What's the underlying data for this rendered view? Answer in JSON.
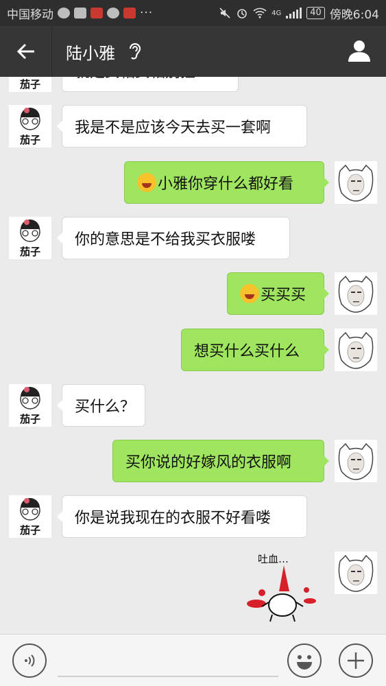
{
  "statusbar": {
    "carrier": "中国移动",
    "network": "4G",
    "battery": "40",
    "time": "傍晚6:04",
    "more": "···"
  },
  "header": {
    "title": "陆小雅"
  },
  "messages": [
    {
      "side": "in",
      "text": "就是女相女相别扭",
      "partial": true
    },
    {
      "side": "in",
      "text": "我是不是应该今天去买一套啊"
    },
    {
      "side": "out",
      "text": "小雅你穿什么都好看",
      "emoji": "laugh-cry-emoji"
    },
    {
      "side": "in",
      "text": "你的意思是不给我买衣服喽"
    },
    {
      "side": "out",
      "text": "买买买",
      "emoji": "laugh-cry-emoji"
    },
    {
      "side": "out",
      "text": "想买什么买什么"
    },
    {
      "side": "in",
      "text": "买什么？"
    },
    {
      "side": "out",
      "text": "买你说的好嫁风的衣服啊"
    },
    {
      "side": "in",
      "text": "你是说我现在的衣服不好看喽"
    },
    {
      "side": "out",
      "sticker_text": "吐血…"
    }
  ],
  "avatars": {
    "contact_label": "茄子"
  },
  "colors": {
    "outgoing_bubble": "#9fe55f",
    "incoming_bubble": "#ffffff",
    "header_bg": "#363636"
  },
  "footer": {
    "voice_icon": "voice-icon",
    "emoji_icon": "smiley-icon",
    "add_icon": "plus-icon"
  }
}
